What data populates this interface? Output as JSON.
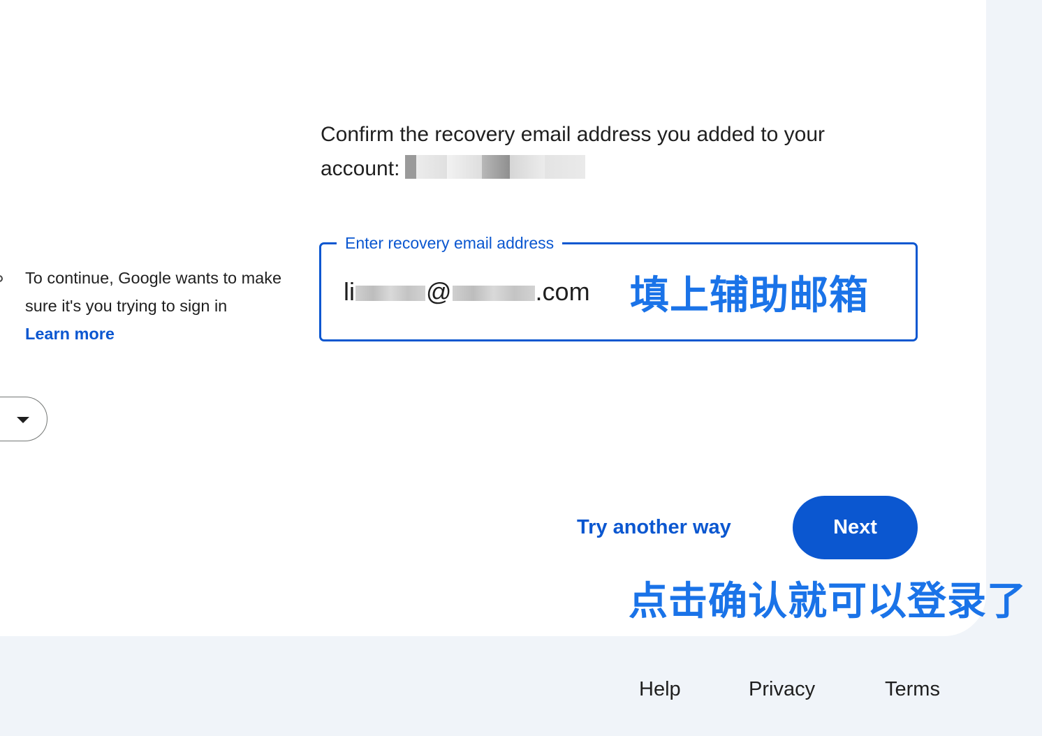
{
  "card": {
    "prompt_text": "Confirm the recovery email address you added to your account:",
    "side_text": "To continue, Google wants to make sure it's you trying to sign in",
    "learn_more": "Learn more"
  },
  "recovery_field": {
    "label": "Enter recovery email address",
    "value_prefix": "li",
    "value_at": "@",
    "value_suffix": ".com"
  },
  "annotations": {
    "fill_hint": "填上辅助邮箱",
    "next_hint": "点击确认就可以登录了"
  },
  "actions": {
    "try_another_way": "Try another way",
    "next": "Next"
  },
  "footer": {
    "help": "Help",
    "privacy": "Privacy",
    "terms": "Terms"
  },
  "colors": {
    "accent": "#0b57d0",
    "annotation": "#1a73e8",
    "page_background": "#f0f4f9",
    "card_background": "#ffffff"
  },
  "icons": {
    "chip_dropdown": "caret-down-icon"
  }
}
